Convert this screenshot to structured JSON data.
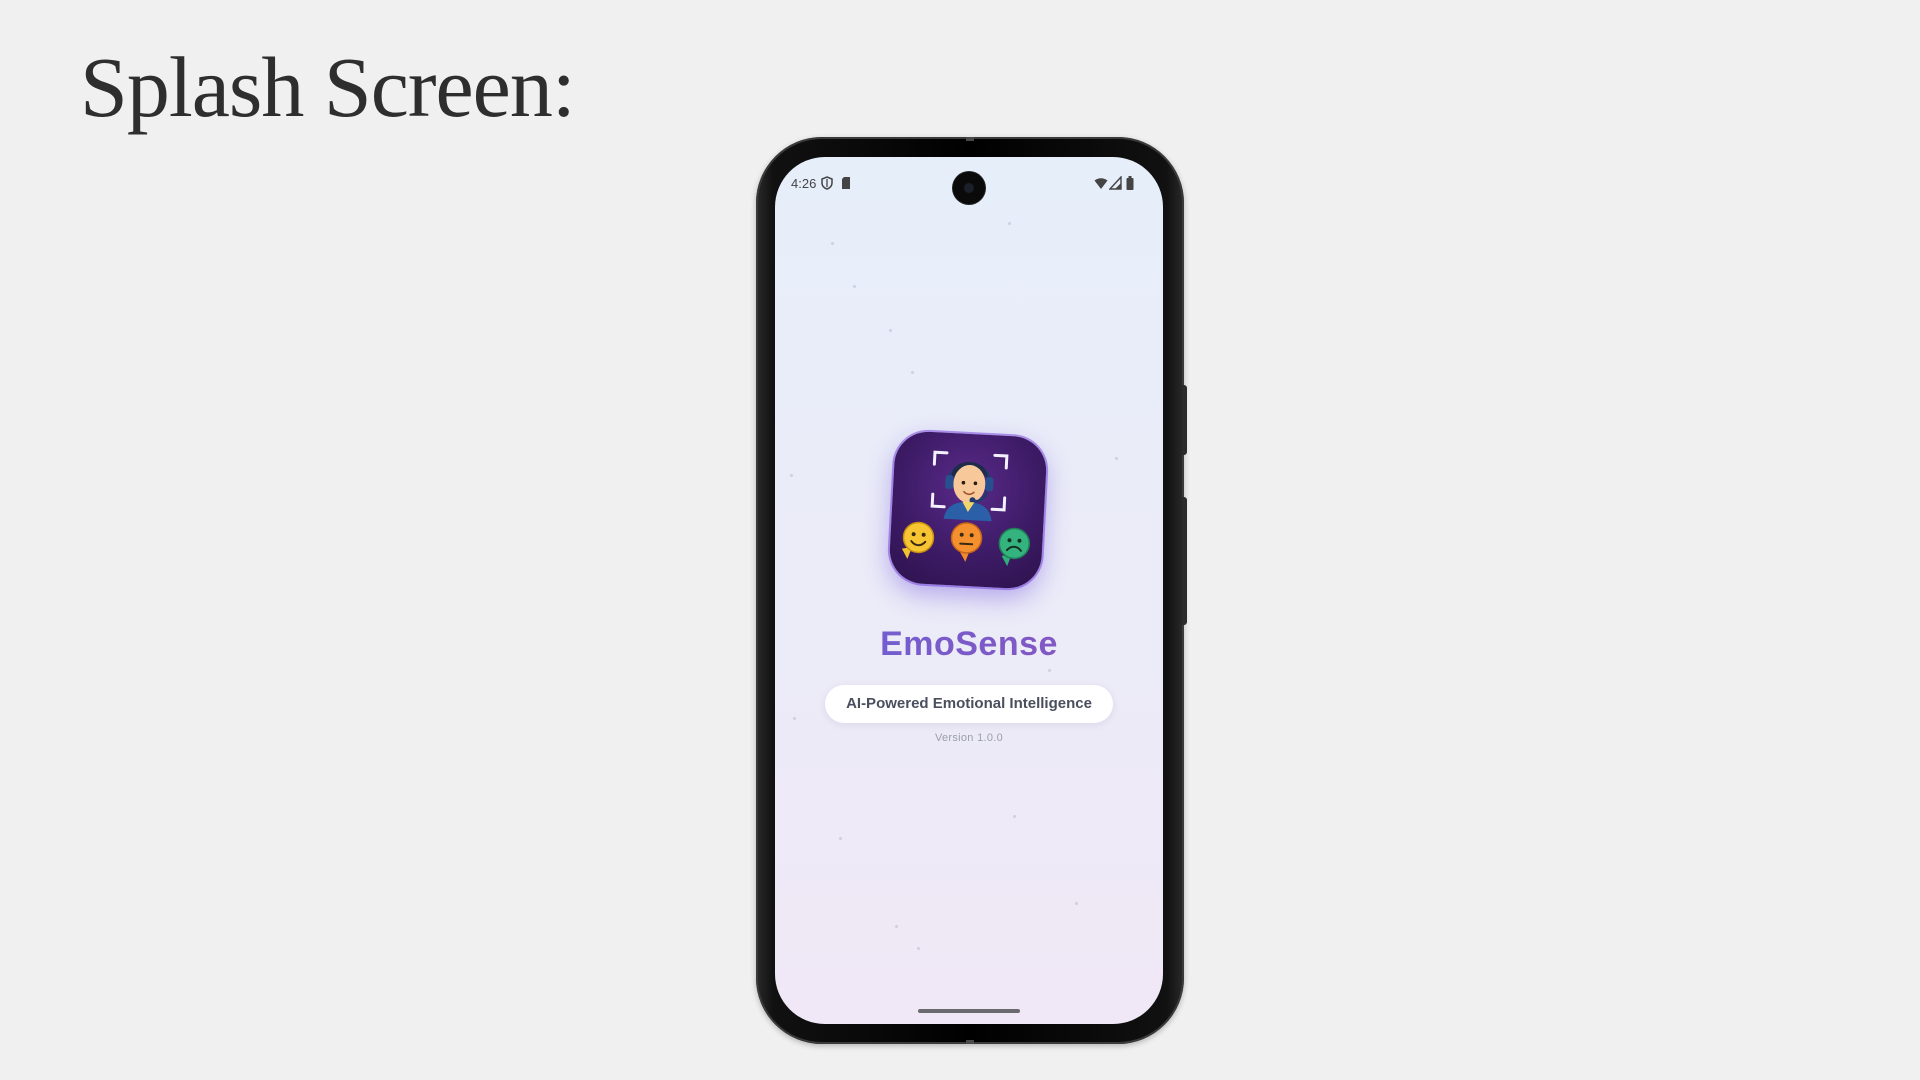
{
  "slide": {
    "title": "Splash Screen:"
  },
  "status_bar": {
    "time": "4:26",
    "left_icons": [
      "vpn-shield-icon",
      "sd-card-icon"
    ],
    "right_icons": [
      "wifi-icon",
      "cellular-signal-icon",
      "battery-icon"
    ]
  },
  "app": {
    "name": "EmoSense",
    "tagline": "AI-Powered Emotional Intelligence",
    "version": "Version 1.0.0",
    "icon": "emosense-logo-icon"
  },
  "colors": {
    "background": "#f0f0f0",
    "screen_gradient_top": "#e6eefa",
    "screen_gradient_bottom": "#f0e8f6",
    "app_name_gradient_start": "#6a63d8",
    "app_name_gradient_end": "#8c55bd",
    "icon_background": "#3d1b66",
    "tagline_text": "#4a4f5e",
    "version_text": "#9a9eab"
  }
}
